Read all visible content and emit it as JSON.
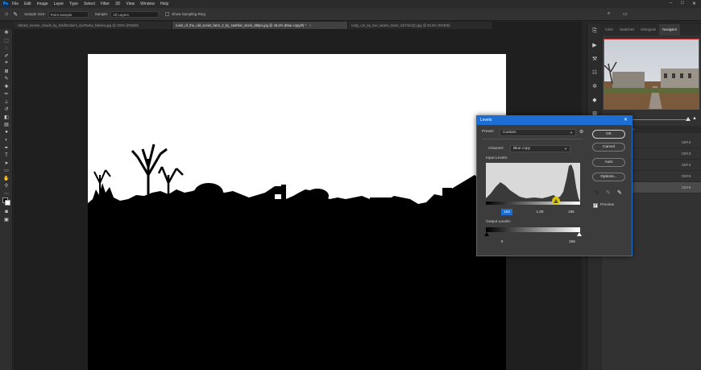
{
  "menubar": {
    "logo": "Ps",
    "items": [
      "File",
      "Edit",
      "Image",
      "Layer",
      "Type",
      "Select",
      "Filter",
      "3D",
      "View",
      "Window",
      "Help"
    ]
  },
  "options_bar": {
    "sample_size_label": "Sample Size:",
    "sample_size_value": "Point Sample",
    "sample_label": "Sample:",
    "sample_value": "All Layers",
    "show_ring_label": "Show Sampling Ring"
  },
  "tabs": [
    {
      "label": "vibrant_sunset_clouds_by_boldfrontiers_dui7tw4w_fullview.jpg @ 100% (RGB/8)",
      "active": false
    },
    {
      "label": "ruins_of_the_old_soviet_farm_2_by_sashkin_stock_d8lpvi.jpg @ 45,5% (Blue copy/8) *",
      "active": true
    },
    {
      "label": "rusty_car_by_two_ladies_stock_d1f742o(2).jpg @ 33,3% (RGB/8)",
      "active": false
    }
  ],
  "panels": {
    "tabs": [
      "Color",
      "Swatches",
      "Histogram",
      "Navigator"
    ],
    "active_tab": "Navigator",
    "channel_tabs": [
      "Channels",
      "Paths"
    ],
    "channels": [
      {
        "name": "",
        "shortcut": "Ctrl+2"
      },
      {
        "name": "",
        "shortcut": "Ctrl+3"
      },
      {
        "name": "n",
        "shortcut": "Ctrl+4"
      },
      {
        "name": "",
        "shortcut": "Ctrl+5"
      },
      {
        "name": "e copy",
        "shortcut": "Ctrl+6"
      }
    ]
  },
  "levels": {
    "title": "Levels",
    "preset_label": "Preset:",
    "preset_value": "Custom",
    "channel_label": "Channel:",
    "channel_value": "Blue copy",
    "input_label": "Input Levels:",
    "input_black": "163",
    "input_gamma": "1,00",
    "input_white": "185",
    "output_label": "Output Levels:",
    "output_black": "0",
    "output_white": "255",
    "buttons": {
      "ok": "OK",
      "cancel": "Cancel",
      "auto": "Auto",
      "options": "Options..."
    },
    "preview_label": "Preview",
    "preview_checked": true
  },
  "colors": {
    "accent": "#1c6ed2",
    "highlight": "#e8d400"
  }
}
